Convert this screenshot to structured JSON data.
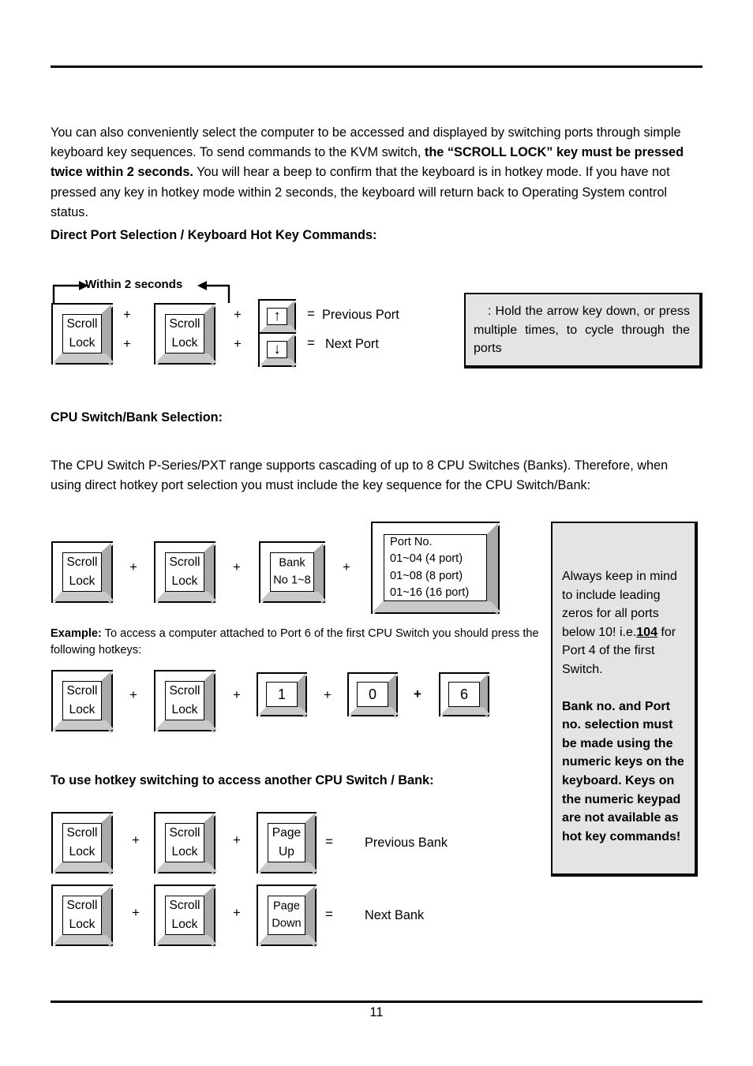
{
  "document": {
    "page_number": "11"
  },
  "intro": {
    "text_1": "You can also conveniently select the computer to be accessed and displayed by switching ports through simple keyboard key sequences. To send commands to the KVM switch, ",
    "bold_1": "the “SCROLL LOCK” key must be pressed twice within 2 seconds.",
    "text_2": " You will hear a beep to confirm that the keyboard is in hotkey mode. If you have not pressed any key in hotkey mode within 2 seconds, the keyboard will return back to Operating System control status."
  },
  "headings": {
    "direct_port": "Direct Port Selection / Keyboard Hot Key Commands:",
    "cpu_bank": "CPU Switch/Bank Selection:",
    "hotkey_switch": "To use hotkey switching to access another CPU Switch / Bank:"
  },
  "diagram1": {
    "within_label": "Within 2 seconds",
    "key1": "Scroll\nLock",
    "key2": "Scroll\nLock",
    "plus_a": "+",
    "plus_b": "+",
    "plus_c": "+",
    "plus_d": "+",
    "arrow_up": "↑",
    "arrow_down": "↓",
    "eq_up": "=",
    "eq_down": "=",
    "result_up": "Previous Port",
    "result_down": "Next Port"
  },
  "note_arrowkey": {
    "text": ":  Hold the arrow key down, or press multiple times, to cycle through the ports"
  },
  "cpu_para": {
    "text": "The CPU Switch P-Series/PXT range supports cascading of up to 8 CPU Switches (Banks). Therefore, when using direct hotkey port selection you must include the key sequence for the CPU Switch/Bank:"
  },
  "diagram2": {
    "key1": "Scroll\nLock",
    "key2": "Scroll\nLock",
    "key3": "Bank\nNo 1~8",
    "key4": "Port No.\n01~04 (4 port)\n01~08 (8 port)\n01~16 (16 port)",
    "plus_a": "+",
    "plus_b": "+",
    "plus_c": "+"
  },
  "example": {
    "bold_label": "Example:",
    "text": " To access a computer attached to Port 6 of the first CPU Switch you should press the following hotkeys:"
  },
  "diagram3": {
    "key1": "Scroll\nLock",
    "key2": "Scroll\nLock",
    "key3": "1",
    "key4": "0",
    "key5": "6",
    "plus_a": "+",
    "plus_b": "+",
    "plus_c": "+",
    "plus_d": "+"
  },
  "note_leadingzeros": {
    "line_plain_1": "Always keep in mind to include leading zeros for all ports below 10! i.e.",
    "bold_underline": "104",
    "line_plain_2": " for Port 4 of the first Switch.",
    "bold_block": "Bank no. and Port no. selection must be made using the numeric keys on the keyboard. Keys on the numeric keypad are not available as hot key commands!"
  },
  "diagram4": {
    "row1": {
      "key1": "Scroll\nLock",
      "key2": "Scroll\nLock",
      "key3": "Page\nUp",
      "plus_a": "+",
      "plus_b": "+",
      "equals": "=",
      "result": "Previous Bank"
    },
    "row2": {
      "key1": "Scroll\nLock",
      "key2": "Scroll\nLock",
      "key3": "Page\nDown",
      "plus_a": "+",
      "plus_b": "+",
      "equals": "=",
      "result": "Next Bank"
    }
  },
  "colors": {
    "key_bevel_light": "#ffffff",
    "key_bevel_dark": "#a9a9a9",
    "key_bevel_bottom": "#c9c9c9",
    "note_background": "#e4e4e4",
    "ink": "#000000"
  }
}
